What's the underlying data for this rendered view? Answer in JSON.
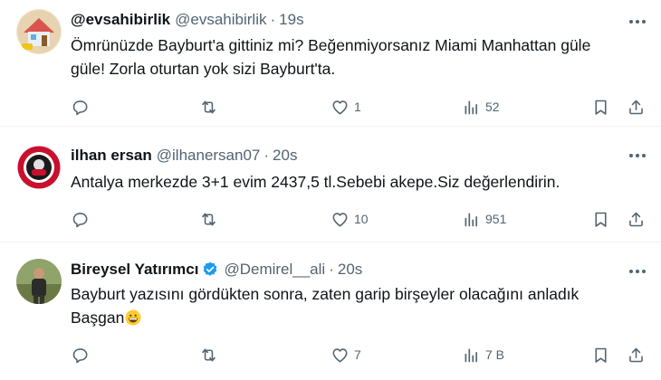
{
  "tweets": [
    {
      "name": "@evsahibirlik",
      "handle": "@evsahibirlik",
      "separator": "·",
      "time": "19s",
      "lines": [
        "Ömrünüzde Bayburt'a gittiniz mi? Beğenmiyorsanız Miami Manhattan güle",
        "güle! Zorla oturtan yok sizi Bayburt'ta."
      ],
      "replies": "",
      "retweets": "",
      "likes": "1",
      "views": "52",
      "avatar_color": "#d9534f"
    },
    {
      "name": "ilhan ersan",
      "handle": "@ilhanersan07",
      "separator": "·",
      "time": "20s",
      "lines": [
        "Antalya merkezde 3+1 evim 2437,5 tl.Sebebi akepe.Siz değerlendirin."
      ],
      "replies": "",
      "retweets": "",
      "likes": "10",
      "views": "951",
      "avatar_color": "#c8102e"
    },
    {
      "name": "Bireysel Yatırımcı",
      "handle": "@Demirel__ali",
      "separator": "·",
      "time": "20s",
      "verified": true,
      "lines": [
        "Bayburt yazısını gördükten sonra, zaten garip birşeyler olacağını anladık",
        "Başgan"
      ],
      "emoji": "grinning-face-emoji",
      "replies": "",
      "retweets": "",
      "likes": "7",
      "views": "7 B",
      "avatar_color": "#7a8a5a"
    }
  ],
  "colors": {
    "text": "#0f1419",
    "muted": "#536471",
    "verified": "#1d9bf0",
    "divider": "#eff3f4"
  },
  "icons": [
    "reply-icon",
    "retweet-icon",
    "like-icon",
    "views-icon",
    "bookmark-icon",
    "share-icon",
    "more-icon",
    "verified-badge-icon"
  ]
}
